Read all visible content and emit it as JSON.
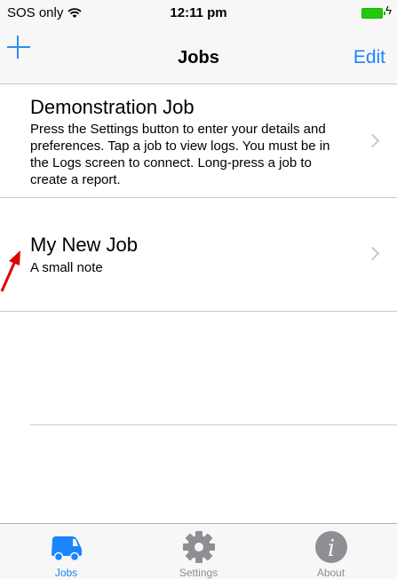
{
  "status_bar": {
    "carrier": "SOS only",
    "time": "12:11 pm"
  },
  "nav": {
    "title": "Jobs",
    "edit_label": "Edit"
  },
  "jobs": [
    {
      "title": "Demonstration Job",
      "description": "Press the Settings button to enter your details and preferences. Tap a job to view logs. You must be in the Logs screen to connect. Long-press a job to create a report."
    },
    {
      "title": "My New Job",
      "description": "A small note"
    }
  ],
  "tabs": [
    {
      "label": "Jobs",
      "icon": "van-icon",
      "active": true
    },
    {
      "label": "Settings",
      "icon": "gear-icon",
      "active": false
    },
    {
      "label": "About",
      "icon": "info-icon",
      "active": false
    }
  ],
  "colors": {
    "accent": "#1a85ff",
    "inactive": "#8e8e93",
    "annotation": "#e00000",
    "battery": "#22c80a"
  }
}
